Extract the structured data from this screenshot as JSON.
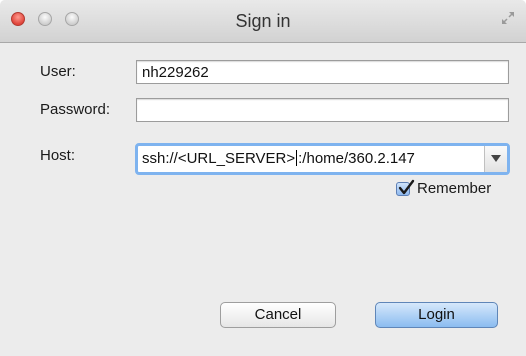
{
  "window": {
    "title": "Sign in"
  },
  "form": {
    "user_label": "User:",
    "user_value": "nh229262",
    "password_label": "Password:",
    "password_value": "",
    "host_label": "Host:",
    "host_value_before_cursor": "ssh://<URL_SERVER>",
    "host_value_after_cursor": ":/home/360.2.147",
    "remember_label": "Remember",
    "remember_checked": true
  },
  "buttons": {
    "cancel_label": "Cancel",
    "login_label": "Login"
  },
  "colors": {
    "focus_ring": "#7eb3ef",
    "default_button": "#8bbcf0",
    "close_light": "#e0443a"
  }
}
